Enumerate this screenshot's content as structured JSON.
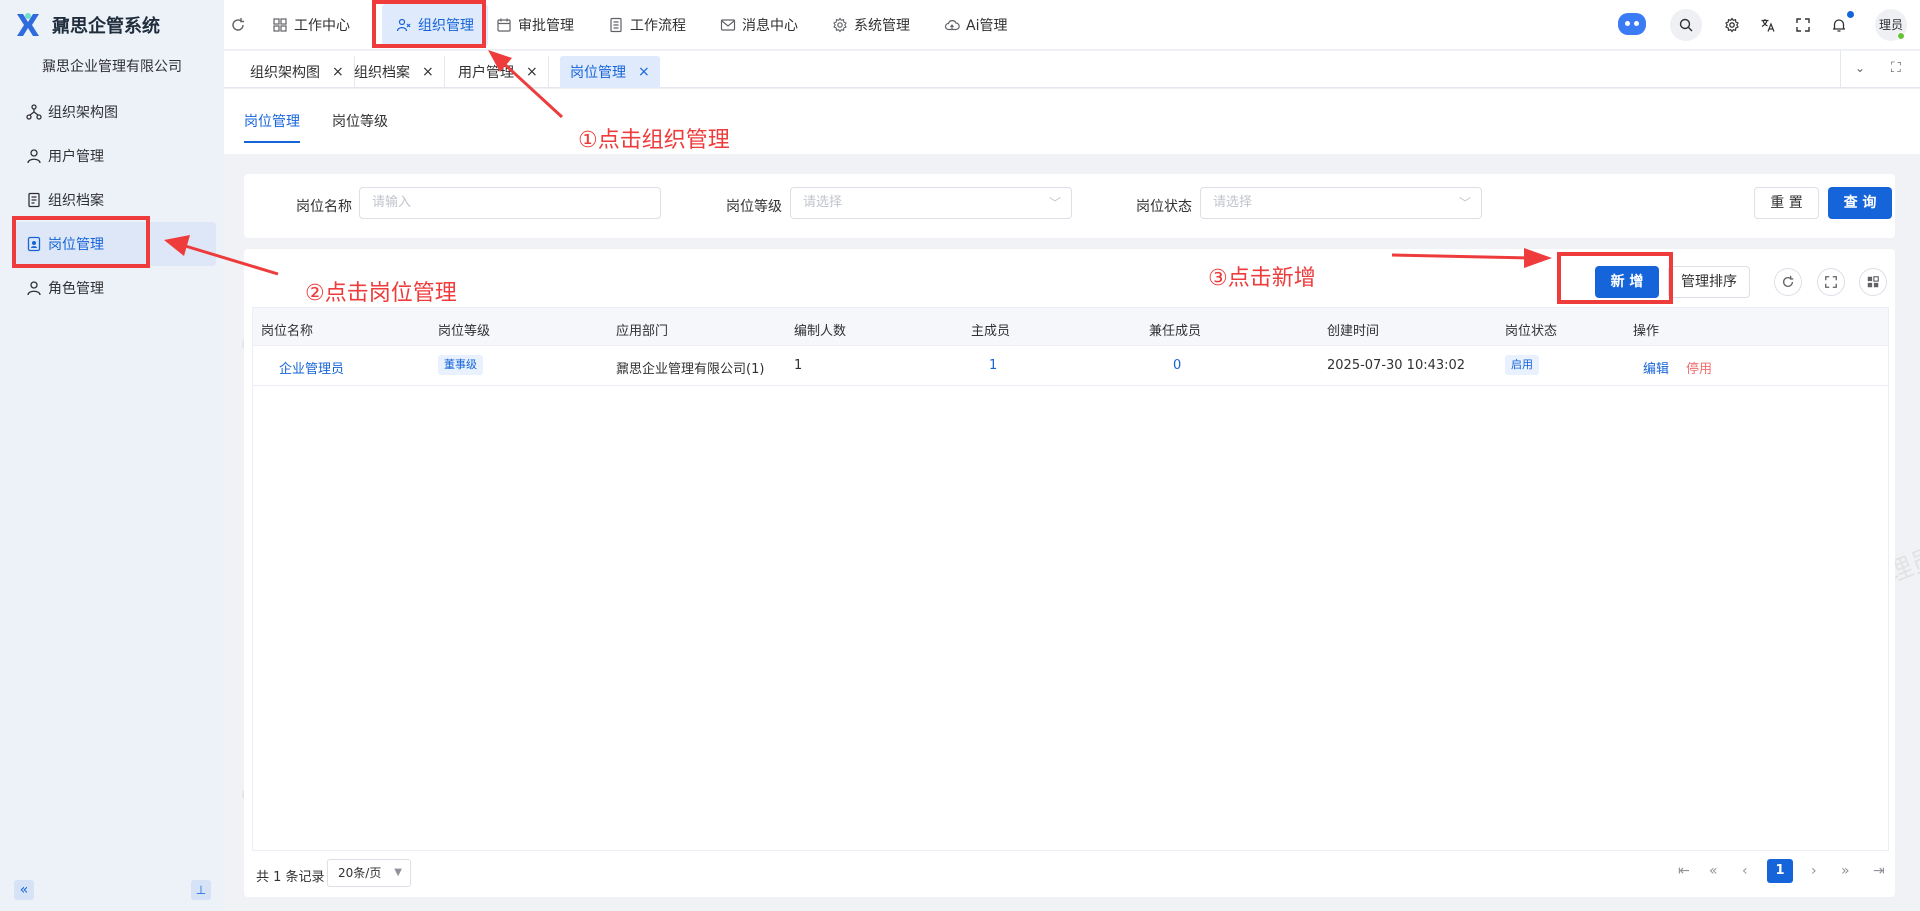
{
  "brand": {
    "title": "鼐思企管系统",
    "company": "鼐思企业管理有限公司"
  },
  "sidebar": {
    "items": [
      {
        "label": "组织架构图",
        "icon": "org-tree-icon"
      },
      {
        "label": "用户管理",
        "icon": "user-icon"
      },
      {
        "label": "组织档案",
        "icon": "archive-icon"
      },
      {
        "label": "岗位管理",
        "icon": "post-icon",
        "active": true
      },
      {
        "label": "角色管理",
        "icon": "role-icon"
      }
    ]
  },
  "topnav": {
    "items": [
      {
        "label": "工作中心"
      },
      {
        "label": "组织管理",
        "active": true
      },
      {
        "label": "审批管理"
      },
      {
        "label": "工作流程"
      },
      {
        "label": "消息中心"
      },
      {
        "label": "系统管理"
      },
      {
        "label": "Ai管理"
      }
    ],
    "avatar_text": "理员"
  },
  "page_tabs": [
    {
      "label": "组织架构图"
    },
    {
      "label": "组织档案"
    },
    {
      "label": "用户管理"
    },
    {
      "label": "岗位管理",
      "active": true
    }
  ],
  "sub_tabs": [
    {
      "label": "岗位管理",
      "active": true
    },
    {
      "label": "岗位等级"
    }
  ],
  "filter": {
    "name_label": "岗位名称",
    "name_placeholder": "请输入",
    "level_label": "岗位等级",
    "level_placeholder": "请选择",
    "status_label": "岗位状态",
    "status_placeholder": "请选择",
    "reset_label": "重 置",
    "query_label": "查 询"
  },
  "toolbar": {
    "add_label": "新 增",
    "sort_label": "管理排序"
  },
  "table": {
    "columns": [
      "岗位名称",
      "岗位等级",
      "应用部门",
      "编制人数",
      "主成员",
      "兼任成员",
      "创建时间",
      "岗位状态",
      "操作"
    ],
    "rows": [
      {
        "name": "企业管理员",
        "level": "董事级",
        "dept": "鼐思企业管理有限公司(1)",
        "headcount": "1",
        "main_members": "1",
        "part_members": "0",
        "created": "2025-07-30 10:43:02",
        "status": "启用",
        "edit": "编辑",
        "disable": "停用"
      }
    ]
  },
  "pagination": {
    "total": "共 1 条记录",
    "page_size": "20条/页",
    "current": "1"
  },
  "annotations": {
    "step1": "①点击组织管理",
    "step2": "②点击岗位管理",
    "step3": "③点击新增"
  },
  "watermark": "管理员",
  "colors": {
    "accent": "#1664d9",
    "annotation": "#ee3b3b",
    "danger": "#f56c6c"
  }
}
